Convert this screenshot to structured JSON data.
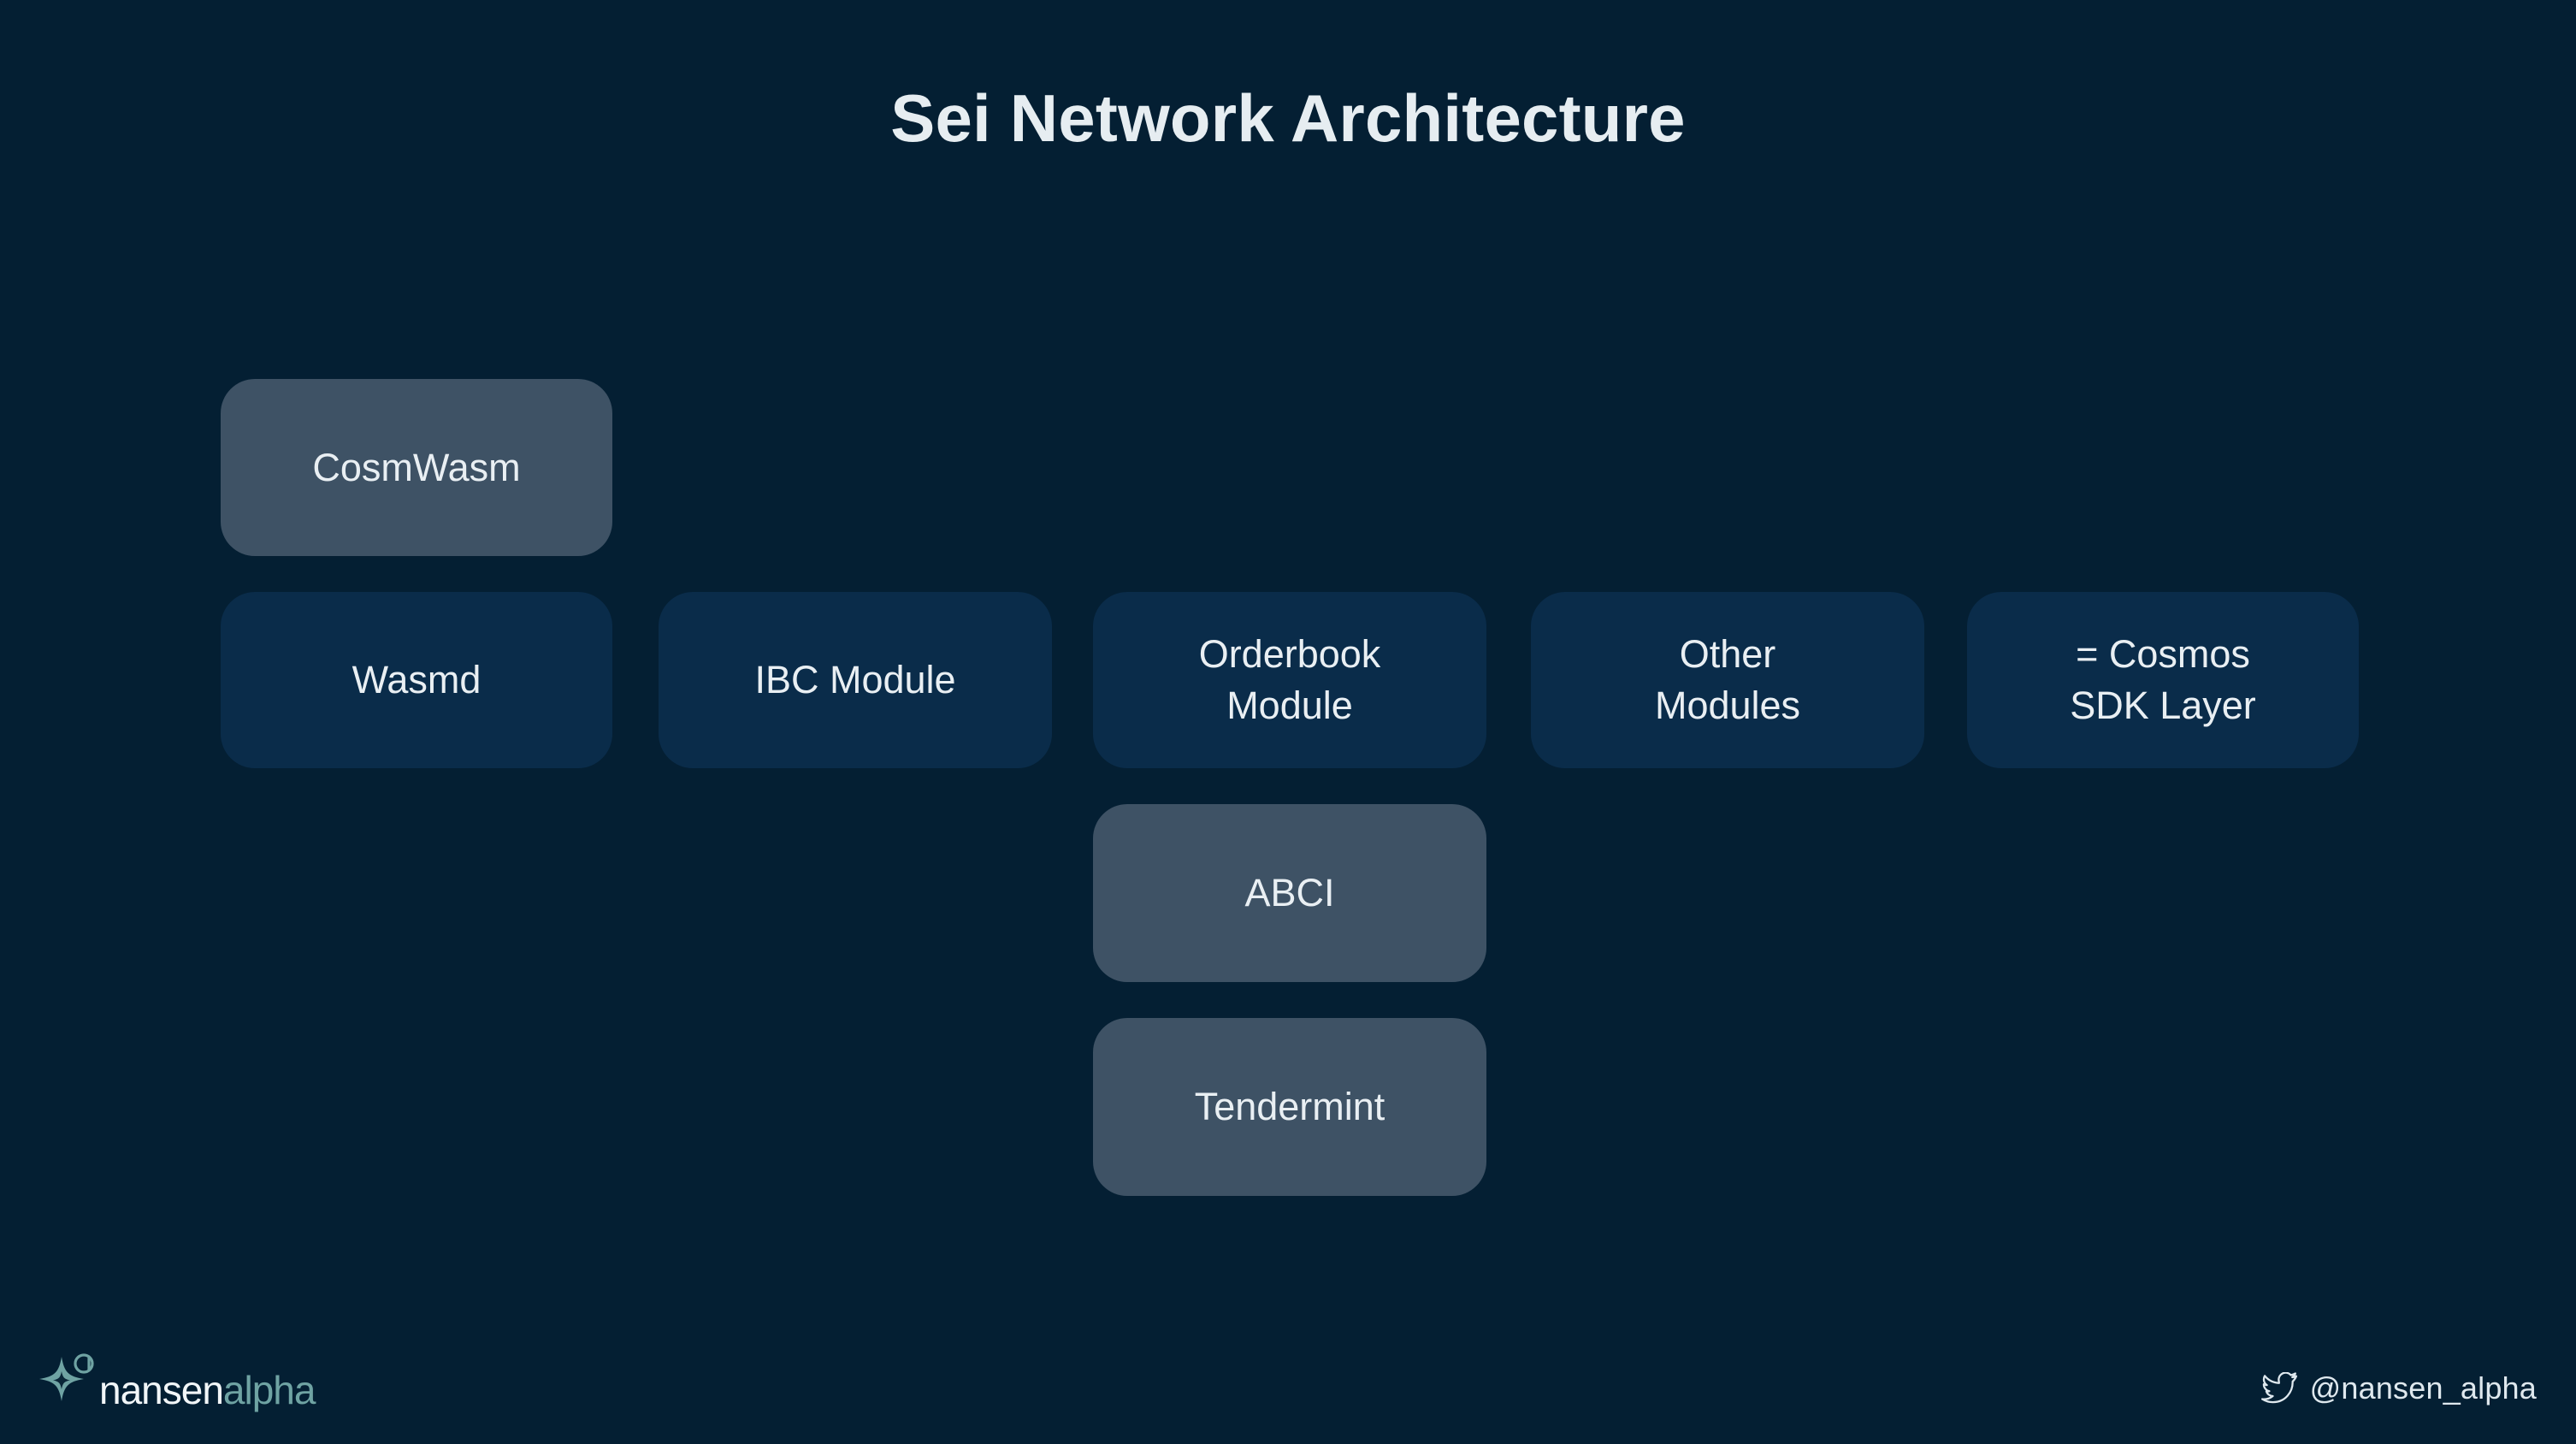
{
  "slide": {
    "title": "Sei Network Architecture",
    "background_color": "#041f33"
  },
  "colors": {
    "background": "#041f33",
    "slate_node": "#3e5265",
    "navy_node": "#0a2c4a",
    "text": "#e9eff3",
    "logo_accent": "#6fa3a3"
  },
  "chart_data": {
    "type": "diagram",
    "title": "Sei Network Architecture",
    "nodes": [
      {
        "id": "cosmwasm",
        "label": "CosmWasm",
        "style": "slate",
        "row": 1,
        "column": 1
      },
      {
        "id": "wasmd",
        "label": "Wasmd",
        "style": "navy",
        "row": 2,
        "column": 1
      },
      {
        "id": "ibc",
        "label": "IBC Module",
        "style": "navy",
        "row": 2,
        "column": 2
      },
      {
        "id": "orderbook",
        "label": "Orderbook\nModule",
        "style": "navy",
        "row": 2,
        "column": 3
      },
      {
        "id": "other",
        "label": "Other\nModules",
        "style": "navy",
        "row": 2,
        "column": 4
      },
      {
        "id": "cosmos-sdk",
        "label": "= Cosmos\nSDK Layer",
        "style": "navy",
        "row": 2,
        "column": 5
      },
      {
        "id": "abci",
        "label": "ABCI",
        "style": "slate",
        "row": 3,
        "column": 3
      },
      {
        "id": "tendermint",
        "label": "Tendermint",
        "style": "slate",
        "row": 4,
        "column": 3
      }
    ]
  },
  "nodes": {
    "cosmwasm": "CosmWasm",
    "wasmd": "Wasmd",
    "ibc": "IBC Module",
    "orderbook": "Orderbook\nModule",
    "other": "Other\nModules",
    "cosmos_sdk": "= Cosmos\nSDK Layer",
    "abci": "ABCI",
    "tendermint": "Tendermint"
  },
  "footer": {
    "logo": {
      "brand": "nansen",
      "product": "alpha",
      "mark": "four-point-star-icon",
      "superscript": "a"
    },
    "social": {
      "icon": "twitter-icon",
      "handle": "@nansen_alpha"
    }
  }
}
